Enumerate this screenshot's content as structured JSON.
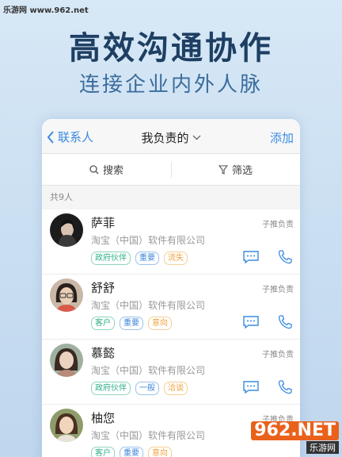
{
  "watermark": {
    "top_left": "乐游网 www.962.net",
    "bottom_right_logo": "962.NET",
    "bottom_right_text": "乐游网"
  },
  "hero": {
    "title": "高效沟通协作",
    "subtitle": "连接企业内外人脉"
  },
  "nav": {
    "back_label": "联系人",
    "title": "我负责的",
    "add_label": "添加"
  },
  "toolbar": {
    "search_label": "搜索",
    "filter_label": "筛选"
  },
  "list_count": "共9人",
  "contacts": [
    {
      "name": "萨菲",
      "owner": "子推负责",
      "company": "淘宝（中国）软件有限公司",
      "tags": [
        "政府伙伴",
        "重要",
        "流失"
      ]
    },
    {
      "name": "舒舒",
      "owner": "子推负责",
      "company": "淘宝（中国）软件有限公司",
      "tags": [
        "客户",
        "重要",
        "意向"
      ]
    },
    {
      "name": "慕懿",
      "owner": "子推负责",
      "company": "淘宝（中国）软件有限公司",
      "tags": [
        "政府伙伴",
        "一般",
        "洽谈"
      ]
    },
    {
      "name": "柚您",
      "owner": "子推负责",
      "company": "淘宝（中国）软件有限公司",
      "tags": [
        "客户",
        "重要",
        "意向"
      ]
    }
  ],
  "colors": {
    "accent": "#3a8be0",
    "tag_green": "#2fb08a",
    "tag_blue": "#3d86d8",
    "tag_orange": "#f0a03a"
  }
}
